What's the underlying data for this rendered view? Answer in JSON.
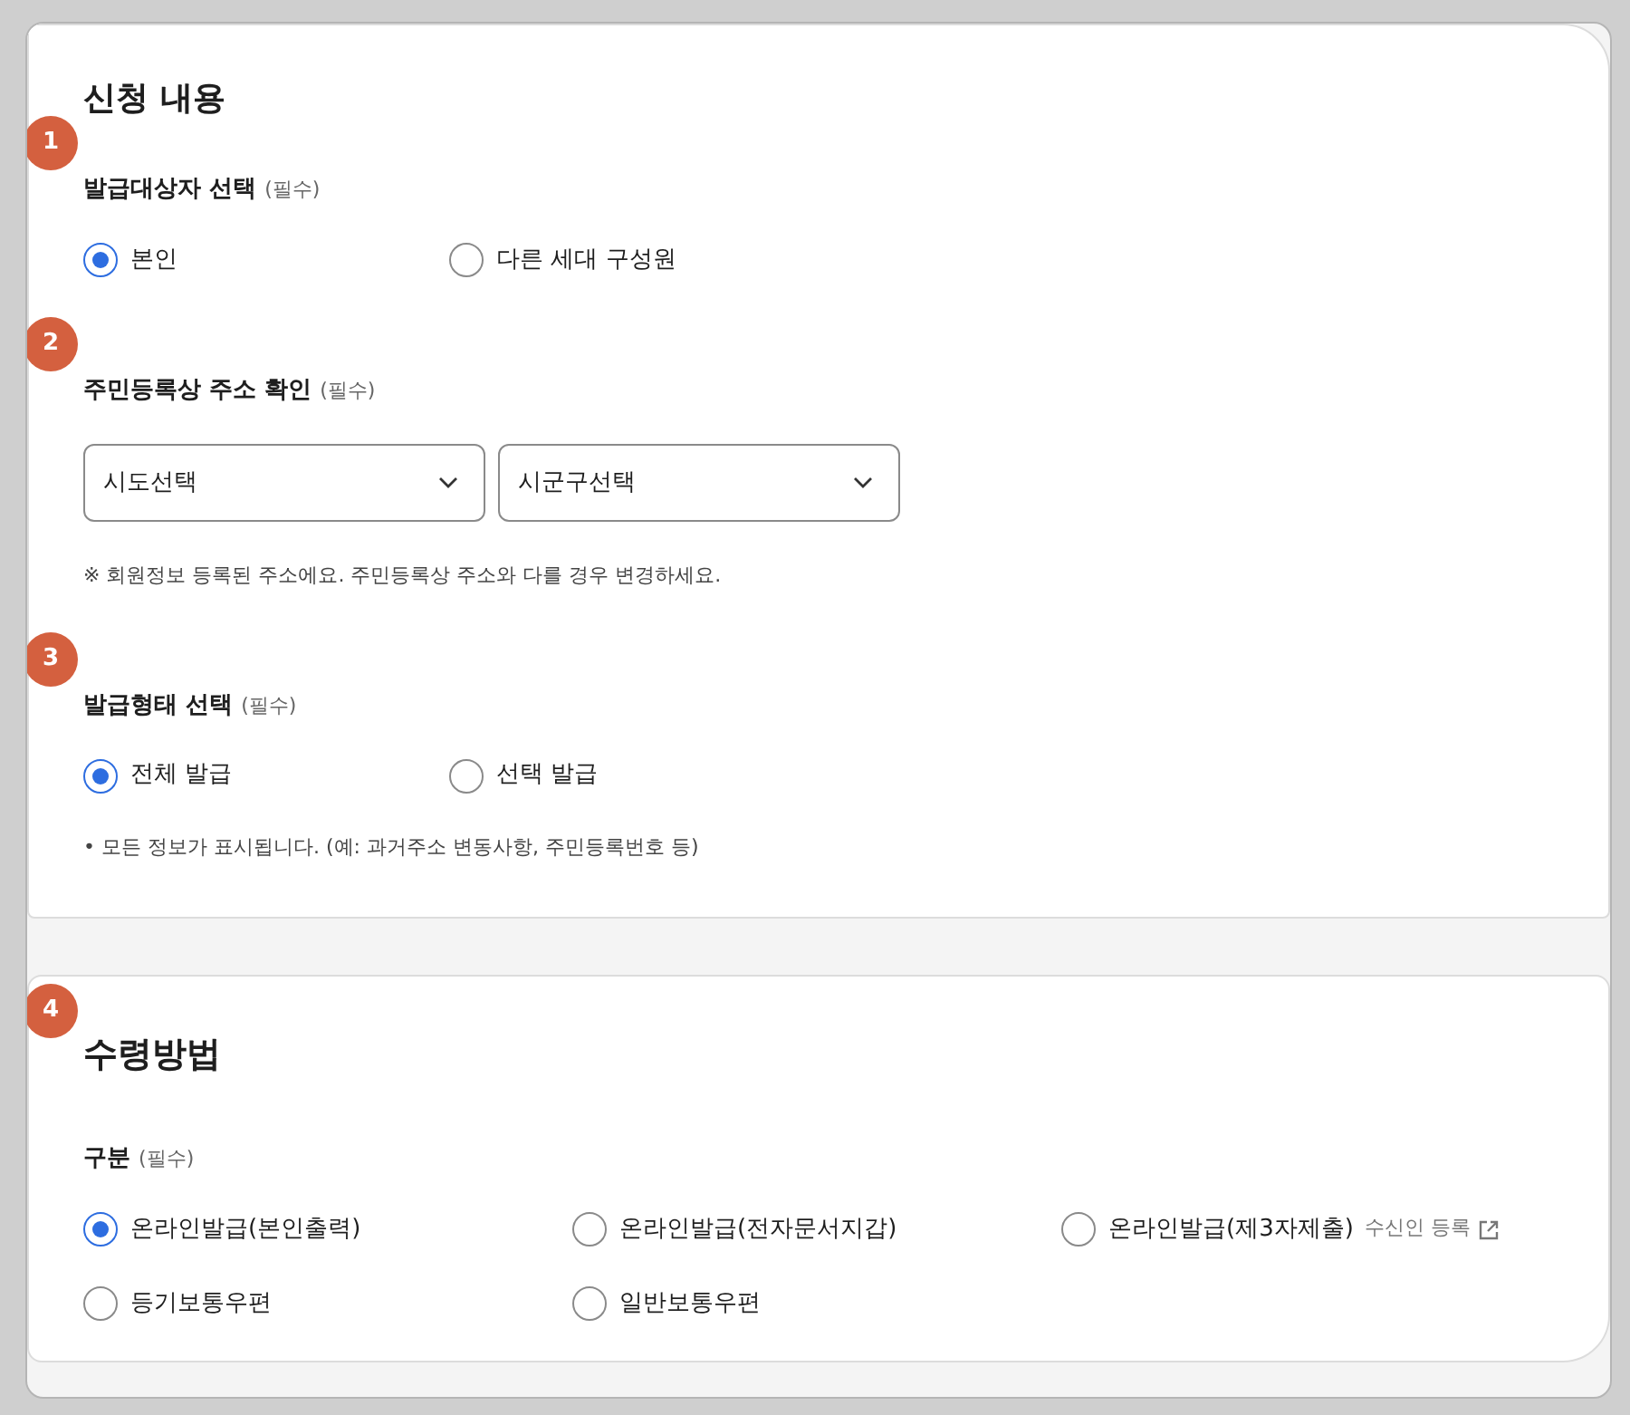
{
  "cards": [
    {
      "title": "신청 내용",
      "groups": [
        {
          "number": "1",
          "kind": "radios",
          "label": "발급대상자 선택",
          "required": "(필수)",
          "options": [
            {
              "label": "본인",
              "selected": true
            },
            {
              "label": "다른 세대 구성원",
              "selected": false
            }
          ]
        },
        {
          "number": "2",
          "kind": "selects",
          "label": "주민등록상 주소 확인",
          "required": "(필수)",
          "selects": [
            "시도선택",
            "시군구선택"
          ],
          "note": "※ 회원정보 등록된 주소에요. 주민등록상 주소와 다를 경우 변경하세요."
        },
        {
          "number": "3",
          "kind": "radios",
          "label": "발급형태 선택",
          "required": "(필수)",
          "options": [
            {
              "label": "전체 발급",
              "selected": true
            },
            {
              "label": "선택 발급",
              "selected": false
            }
          ],
          "note": "• 모든 정보가 표시됩니다. (예: 과거주소 변동사항, 주민등록번호 등)"
        }
      ]
    },
    {
      "number": "4",
      "title": "수령방법",
      "groups": [
        {
          "kind": "radios",
          "label": "구분",
          "required": "(필수)",
          "options": [
            {
              "label": "온라인발급(본인출력)",
              "selected": true
            },
            {
              "label": "온라인발급(전자문서지갑)",
              "selected": false
            },
            {
              "label": "온라인발급(제3자제출)",
              "selected": false,
              "link": "수신인 등록"
            },
            {
              "label": "등기보통우편",
              "selected": false
            },
            {
              "label": "일반보통우편",
              "selected": false
            }
          ]
        }
      ]
    }
  ]
}
